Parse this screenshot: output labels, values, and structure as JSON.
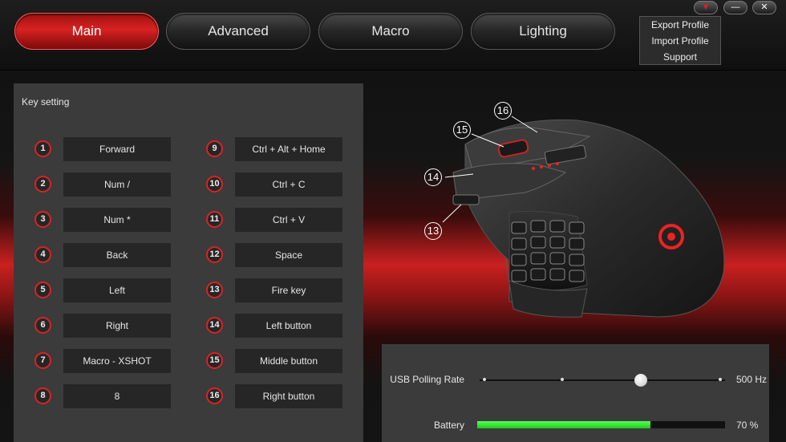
{
  "tabs": [
    {
      "label": "Main",
      "active": true
    },
    {
      "label": "Advanced",
      "active": false
    },
    {
      "label": "Macro",
      "active": false
    },
    {
      "label": "Lighting",
      "active": false
    }
  ],
  "window_controls": {
    "menu": "▼",
    "minimize": "—",
    "close": "✕"
  },
  "menu_items": [
    "Export Profile",
    "Import Profile",
    "Support"
  ],
  "key_setting": {
    "title": "Key setting",
    "keys": [
      {
        "num": "1",
        "label": "Forward"
      },
      {
        "num": "2",
        "label": "Num /"
      },
      {
        "num": "3",
        "label": "Num *"
      },
      {
        "num": "4",
        "label": "Back"
      },
      {
        "num": "5",
        "label": "Left"
      },
      {
        "num": "6",
        "label": "Right"
      },
      {
        "num": "7",
        "label": "Macro - XSHOT"
      },
      {
        "num": "8",
        "label": "8"
      },
      {
        "num": "9",
        "label": "Ctrl + Alt + Home"
      },
      {
        "num": "10",
        "label": "Ctrl + C"
      },
      {
        "num": "11",
        "label": "Ctrl + V"
      },
      {
        "num": "12",
        "label": "Space"
      },
      {
        "num": "13",
        "label": "Fire key"
      },
      {
        "num": "14",
        "label": "Left button"
      },
      {
        "num": "15",
        "label": "Middle button"
      },
      {
        "num": "16",
        "label": "Right button"
      }
    ]
  },
  "mouse_callouts": [
    "16",
    "15",
    "14",
    "13"
  ],
  "usb_polling": {
    "label": "USB Polling Rate",
    "value": "500 Hz",
    "positions": 4,
    "selected_index": 2
  },
  "battery": {
    "label": "Battery",
    "value": "70 %",
    "level": 0.7
  },
  "colors": {
    "accent": "#d22020",
    "battery": "#2ee02e"
  }
}
